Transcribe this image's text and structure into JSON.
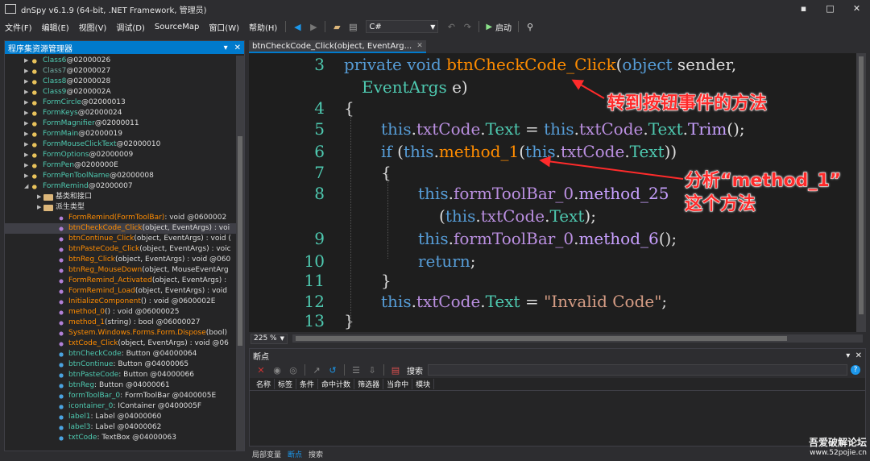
{
  "window": {
    "title": "dnSpy v6.1.9 (64-bit, .NET Framework, 管理员)",
    "controls": {
      "minimize": "▪",
      "maximize": "□",
      "close": "✕"
    }
  },
  "menu": {
    "items": [
      "文件(F)",
      "编辑(E)",
      "视图(V)",
      "调试(D)",
      "SourceMap",
      "窗口(W)",
      "帮助(H)"
    ],
    "language": "C#",
    "run_label": "启动"
  },
  "explorer": {
    "title": "程序集资源管理器",
    "items": [
      {
        "kind": "class",
        "name": "Class6",
        "meta": " @02000026",
        "expanded": false,
        "indent": 1
      },
      {
        "kind": "class",
        "name": "Class7",
        "meta": " @02000027",
        "expanded": false,
        "indent": 1,
        "dim": true
      },
      {
        "kind": "class",
        "name": "Class8",
        "meta": " @02000028",
        "expanded": false,
        "indent": 1
      },
      {
        "kind": "class",
        "name": "Class9",
        "meta": " @0200002A",
        "expanded": false,
        "indent": 1
      },
      {
        "kind": "class",
        "name": "FormCircle",
        "meta": " @02000013",
        "expanded": false,
        "indent": 1
      },
      {
        "kind": "class",
        "name": "FormKeys",
        "meta": " @02000024",
        "expanded": false,
        "indent": 1
      },
      {
        "kind": "class",
        "name": "FormMagnifier",
        "meta": " @02000011",
        "expanded": false,
        "indent": 1
      },
      {
        "kind": "class",
        "name": "FormMain",
        "meta": " @02000019",
        "expanded": false,
        "indent": 1
      },
      {
        "kind": "class",
        "name": "FormMouseClickText",
        "meta": " @02000010",
        "expanded": false,
        "indent": 1
      },
      {
        "kind": "class",
        "name": "FormOptions",
        "meta": " @02000009",
        "expanded": false,
        "indent": 1
      },
      {
        "kind": "class",
        "name": "FormPen",
        "meta": " @0200000E",
        "expanded": false,
        "indent": 1
      },
      {
        "kind": "class",
        "name": "FormPenToolName",
        "meta": " @02000008",
        "expanded": false,
        "indent": 1
      },
      {
        "kind": "class",
        "name": "FormRemind",
        "meta": " @02000007",
        "expanded": true,
        "indent": 1
      },
      {
        "kind": "folder",
        "name": "基类和接口",
        "meta": "",
        "expanded": false,
        "indent": 2
      },
      {
        "kind": "folder",
        "name": "派生类型",
        "meta": "",
        "expanded": false,
        "indent": 2
      },
      {
        "kind": "ctor",
        "name": "FormRemind(FormToolBar)",
        "meta": " : void @0600002",
        "indent": 3
      },
      {
        "kind": "method",
        "name": "btnCheckCode_Click",
        "meta": "(object, EventArgs) : voi",
        "indent": 3,
        "selected": true
      },
      {
        "kind": "method",
        "name": "btnContinue_Click",
        "meta": "(object, EventArgs) : void (",
        "indent": 3
      },
      {
        "kind": "method",
        "name": "btnPasteCode_Click",
        "meta": "(object, EventArgs) : voic",
        "indent": 3
      },
      {
        "kind": "method",
        "name": "btnReg_Click",
        "meta": "(object, EventArgs) : void @060",
        "indent": 3
      },
      {
        "kind": "method",
        "name": "btnReg_MouseDown",
        "meta": "(object, MouseEventArg",
        "indent": 3
      },
      {
        "kind": "method",
        "name": "FormRemind_Activated",
        "meta": "(object, EventArgs) : ",
        "indent": 3
      },
      {
        "kind": "method",
        "name": "FormRemind_Load",
        "meta": "(object, EventArgs) : void",
        "indent": 3
      },
      {
        "kind": "method",
        "name": "InitializeComponent",
        "meta": "() : void @0600002E",
        "indent": 3
      },
      {
        "kind": "method",
        "name": "method_0",
        "meta": "() : void @06000025",
        "indent": 3
      },
      {
        "kind": "method",
        "name": "method_1",
        "meta": "(string) : bool @06000027",
        "indent": 3
      },
      {
        "kind": "method",
        "name": "System.Windows.Forms.Form.Dispose",
        "meta": "(bool)",
        "indent": 3
      },
      {
        "kind": "method",
        "name": "txtCode_Click",
        "meta": "(object, EventArgs) : void @06",
        "indent": 3
      },
      {
        "kind": "field",
        "name": "btnCheckCode",
        "meta": " : Button @04000064",
        "indent": 3
      },
      {
        "kind": "field",
        "name": "btnContinue",
        "meta": " : Button @04000065",
        "indent": 3
      },
      {
        "kind": "field",
        "name": "btnPasteCode",
        "meta": " : Button @04000066",
        "indent": 3
      },
      {
        "kind": "field",
        "name": "btnReg",
        "meta": " : Button @04000061",
        "indent": 3
      },
      {
        "kind": "field",
        "name": "formToolBar_0",
        "meta": " : FormToolBar @0400005E",
        "indent": 3
      },
      {
        "kind": "field",
        "name": "icontainer_0",
        "meta": " : IContainer @0400005F",
        "indent": 3
      },
      {
        "kind": "field",
        "name": "label1",
        "meta": " : Label @04000060",
        "indent": 3
      },
      {
        "kind": "field",
        "name": "label3",
        "meta": " : Label @04000062",
        "indent": 3
      },
      {
        "kind": "field",
        "name": "txtCode",
        "meta": " : TextBox @04000063",
        "indent": 3
      }
    ]
  },
  "editor": {
    "tab_label": "btnCheckCode_Click(object, EventArg...",
    "zoom": "225 %",
    "lines": [
      {
        "num": "3",
        "parts": [
          [
            "kw",
            "private"
          ],
          [
            "pl",
            " "
          ],
          [
            "kw",
            "void"
          ],
          [
            "pl",
            " "
          ],
          [
            "fn",
            "btnCheckCode_Click"
          ],
          [
            "pl",
            "("
          ],
          [
            "kw",
            "object"
          ],
          [
            "pl",
            " sender,"
          ]
        ]
      },
      {
        "num": "",
        "parts": [
          [
            "ty",
            "EventArgs"
          ],
          [
            "pl",
            " e)"
          ]
        ],
        "indent": 1
      },
      {
        "num": "4",
        "parts": [
          [
            "pl",
            "{"
          ]
        ]
      },
      {
        "num": "5",
        "parts": [
          [
            "kw",
            "this"
          ],
          [
            "pl",
            "."
          ],
          [
            "fd",
            "txtCode"
          ],
          [
            "pl",
            "."
          ],
          [
            "pr",
            "Text"
          ],
          [
            "pl",
            " = "
          ],
          [
            "kw",
            "this"
          ],
          [
            "pl",
            "."
          ],
          [
            "fd",
            "txtCode"
          ],
          [
            "pl",
            "."
          ],
          [
            "pr",
            "Text"
          ],
          [
            "pl",
            "."
          ],
          [
            "mb",
            "Trim"
          ],
          [
            "pl",
            "();"
          ]
        ],
        "indent": 2
      },
      {
        "num": "6",
        "parts": [
          [
            "kw",
            "if"
          ],
          [
            "pl",
            " ("
          ],
          [
            "kw",
            "this"
          ],
          [
            "pl",
            "."
          ],
          [
            "fn",
            "method_1"
          ],
          [
            "pl",
            "("
          ],
          [
            "kw",
            "this"
          ],
          [
            "pl",
            "."
          ],
          [
            "fd",
            "txtCode"
          ],
          [
            "pl",
            "."
          ],
          [
            "pr",
            "Text"
          ],
          [
            "pl",
            "))"
          ]
        ],
        "indent": 2
      },
      {
        "num": "7",
        "parts": [
          [
            "pl",
            "{"
          ]
        ],
        "indent": 2
      },
      {
        "num": "8",
        "parts": [
          [
            "kw",
            "this"
          ],
          [
            "pl",
            "."
          ],
          [
            "fd",
            "formToolBar_0"
          ],
          [
            "pl",
            "."
          ],
          [
            "mb",
            "method_25"
          ]
        ],
        "indent": 4
      },
      {
        "num": "",
        "parts": [
          [
            "pl",
            "("
          ],
          [
            "kw",
            "this"
          ],
          [
            "pl",
            "."
          ],
          [
            "fd",
            "txtCode"
          ],
          [
            "pl",
            "."
          ],
          [
            "pr",
            "Text"
          ],
          [
            "pl",
            ");"
          ]
        ],
        "indent": 5
      },
      {
        "num": "9",
        "parts": [
          [
            "kw",
            "this"
          ],
          [
            "pl",
            "."
          ],
          [
            "fd",
            "formToolBar_0"
          ],
          [
            "pl",
            "."
          ],
          [
            "mb",
            "method_6"
          ],
          [
            "pl",
            "();"
          ]
        ],
        "indent": 4
      },
      {
        "num": "10",
        "parts": [
          [
            "kw",
            "return"
          ],
          [
            "pl",
            ";"
          ]
        ],
        "indent": 4
      },
      {
        "num": "11",
        "parts": [
          [
            "pl",
            "}"
          ]
        ],
        "indent": 2
      },
      {
        "num": "12",
        "parts": [
          [
            "kw",
            "this"
          ],
          [
            "pl",
            "."
          ],
          [
            "fd",
            "txtCode"
          ],
          [
            "pl",
            "."
          ],
          [
            "pr",
            "Text"
          ],
          [
            "pl",
            " = "
          ],
          [
            "st",
            "\"Invalid Code\""
          ],
          [
            "pl",
            ";"
          ]
        ],
        "indent": 2
      },
      {
        "num": "13",
        "parts": [
          [
            "pl",
            "}"
          ]
        ]
      }
    ]
  },
  "annotations": {
    "a1": "转到按钮事件的方法",
    "a2_line1": "分析“method_1”",
    "a2_line2": "这个方法",
    "color": "#ff2b2b"
  },
  "breakpoints": {
    "title": "断点",
    "search_label": "搜索",
    "columns": [
      "名称",
      "标签",
      "条件",
      "命中计数",
      "筛选器",
      "当命中",
      "模块"
    ]
  },
  "bottom_tabs": [
    "局部变量",
    "断点",
    "搜索"
  ],
  "watermark": {
    "line1": "吾爱破解论坛",
    "line2": "www.52pojie.cn"
  }
}
